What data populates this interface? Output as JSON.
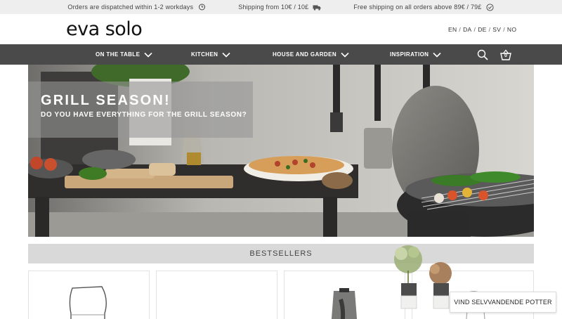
{
  "topbar": {
    "messages": [
      {
        "text": "Orders are dispatched within 1-2 workdays",
        "icon": "clock-icon"
      },
      {
        "text": "Shipping from 10€ / 10£",
        "icon": "truck-icon"
      },
      {
        "text": "Free shipping on all orders above 89€ / 79£",
        "icon": "check-circle-icon"
      }
    ]
  },
  "header": {
    "logo": "eva solo",
    "languages": [
      "EN",
      "DA",
      "DE",
      "SV",
      "NO"
    ]
  },
  "nav": {
    "items": [
      {
        "label": "ON THE TABLE"
      },
      {
        "label": "KITCHEN"
      },
      {
        "label": "HOUSE AND GARDEN"
      },
      {
        "label": "INSPIRATION"
      }
    ],
    "cart_count": "0"
  },
  "hero": {
    "title": "GRILL SEASON!",
    "subtitle": "DO YOU HAVE EVERYTHING FOR THE GRILL SEASON?"
  },
  "bestsellers": {
    "heading": "BESTSELLERS"
  },
  "promo": {
    "label": "VIND SELVVANDENDE POTTER"
  },
  "colors": {
    "nav_bg": "#4a4a4a",
    "topbar_bg": "#eeeeee",
    "section_bg": "#d9d9d9"
  }
}
